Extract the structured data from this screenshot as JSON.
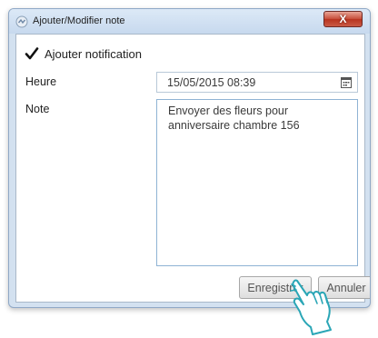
{
  "window": {
    "title": "Ajouter/Modifier note",
    "close_label": "X"
  },
  "form": {
    "notification_checked": true,
    "notification_label": "Ajouter notification",
    "heure_label": "Heure",
    "heure_value": "15/05/2015 08:39",
    "note_label": "Note",
    "note_value": "Envoyer des fleurs pour anniversaire chambre 156"
  },
  "buttons": {
    "save_label": "Enregistrer",
    "cancel_label": "Annuler"
  },
  "icons": {
    "app": "app-icon",
    "check": "checkmark-icon",
    "calendar": "calendar-icon",
    "cursor": "hand-pointer-icon"
  }
}
